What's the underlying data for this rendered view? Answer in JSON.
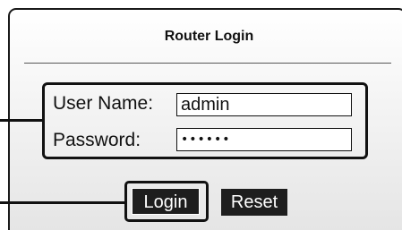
{
  "dialog": {
    "title": "Router Login"
  },
  "form": {
    "username_label": "User Name:",
    "username_value": "admin",
    "password_label": "Password:",
    "password_value": "••••••"
  },
  "buttons": {
    "login_label": "Login",
    "reset_label": "Reset"
  }
}
